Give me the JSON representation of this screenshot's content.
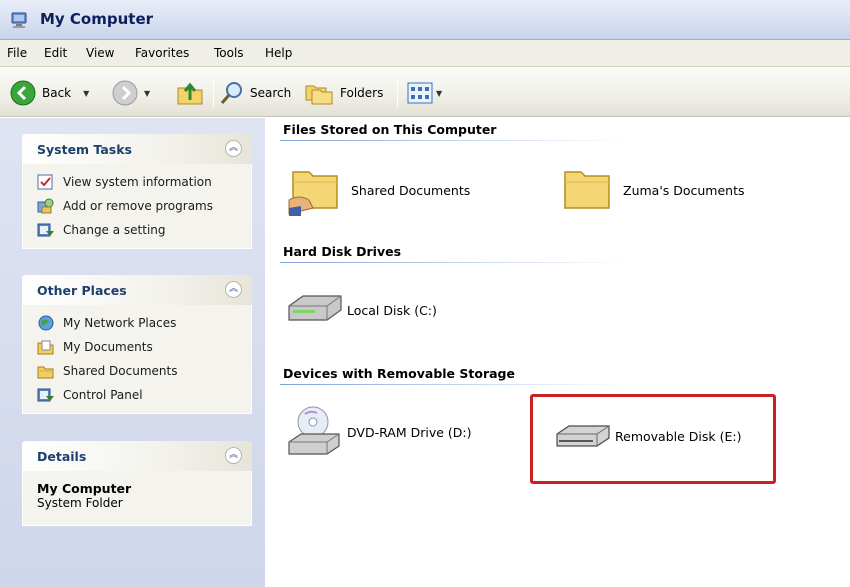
{
  "window": {
    "title": "My Computer"
  },
  "menubar": {
    "items": [
      "File",
      "Edit",
      "View",
      "Favorites",
      "Tools",
      "Help"
    ]
  },
  "toolbar": {
    "back_label": "Back",
    "search_label": "Search",
    "folders_label": "Folders"
  },
  "sidebar": {
    "system_tasks": {
      "title": "System Tasks",
      "items": [
        "View system information",
        "Add or remove programs",
        "Change a setting"
      ]
    },
    "other_places": {
      "title": "Other Places",
      "items": [
        "My Network Places",
        "My Documents",
        "Shared Documents",
        "Control Panel"
      ]
    },
    "details": {
      "title": "Details",
      "name": "My Computer",
      "type": "System Folder"
    }
  },
  "content": {
    "groups": [
      {
        "title": "Files Stored on This Computer",
        "items": [
          "Shared Documents",
          "Zuma's Documents"
        ]
      },
      {
        "title": "Hard Disk Drives",
        "items": [
          "Local Disk (C:)"
        ]
      },
      {
        "title": "Devices with Removable Storage",
        "items": [
          "DVD-RAM Drive (D:)",
          "Removable Disk (E:)"
        ]
      }
    ]
  },
  "colors": {
    "highlight": "#cc1f1f",
    "panel_title": "#1c3f6e",
    "sidebar_bg": "#d5dcef"
  }
}
